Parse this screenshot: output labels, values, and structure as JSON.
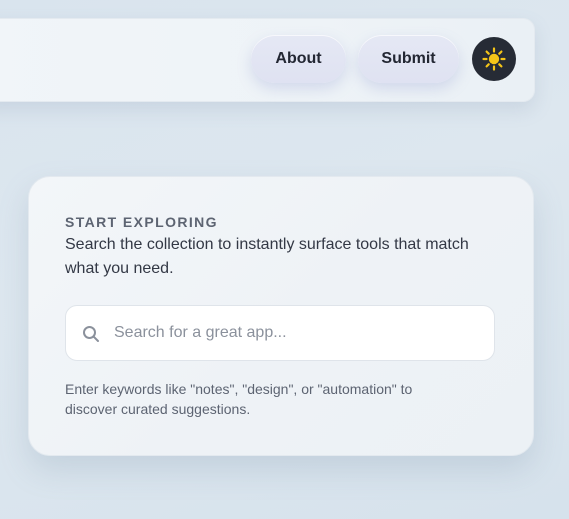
{
  "header": {
    "nav": {
      "about_label": "About",
      "submit_label": "Submit"
    },
    "theme_toggle_icon": "sun-icon",
    "accent_colors": {
      "sun": "#f5c518",
      "toggle_bg": "#262b35"
    }
  },
  "hero": {
    "eyebrow": "START EXPLORING",
    "description": "Search the collection to instantly surface tools that match what you need.",
    "search": {
      "icon": "search-icon",
      "value": "",
      "placeholder": "Search for a great app..."
    },
    "hint": "Enter keywords like \"notes\", \"design\", or \"automation\" to discover curated suggestions."
  }
}
